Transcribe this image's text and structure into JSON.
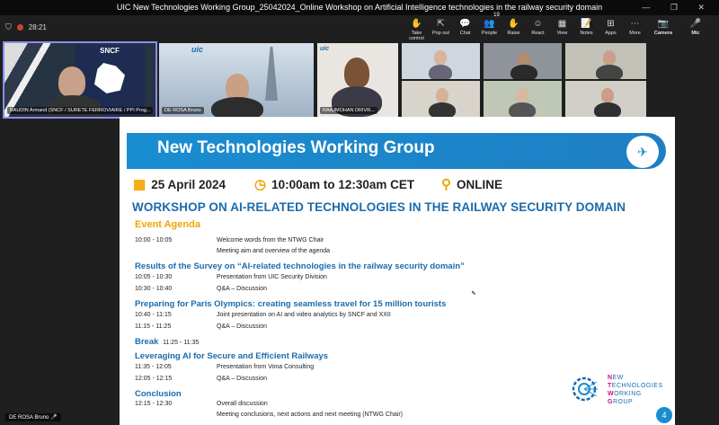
{
  "window": {
    "title": "UIC New Technologies Working Group_25042024_Online Workshop on Artificial Intelligence technologies in the railway security domain",
    "controls": "— ❐ ✕"
  },
  "toolbar": {
    "timer": "28:21",
    "items": [
      {
        "icon": "✋",
        "label": "Take control",
        "name": "take-control-button"
      },
      {
        "icon": "⇱",
        "label": "Pop out",
        "name": "pop-out-button"
      },
      {
        "icon": "💬",
        "label": "Chat",
        "name": "chat-button"
      },
      {
        "icon": "👥",
        "label": "People",
        "name": "people-button",
        "badge": "19"
      },
      {
        "icon": "✋",
        "label": "Raise",
        "name": "raise-hand-button"
      },
      {
        "icon": "☺",
        "label": "React",
        "name": "react-button"
      },
      {
        "icon": "▦",
        "label": "View",
        "name": "view-button"
      },
      {
        "icon": "📝",
        "label": "Notes",
        "name": "notes-button"
      },
      {
        "icon": "⊞",
        "label": "Apps",
        "name": "apps-button"
      },
      {
        "icon": "⋯",
        "label": "More",
        "name": "more-button"
      },
      {
        "icon": "📷",
        "label": "Camera",
        "name": "camera-button"
      },
      {
        "icon": "🎤",
        "label": "Mic",
        "name": "mic-button"
      }
    ]
  },
  "participants": {
    "t1": "BAUDIN Armand (SNCF / SURETE FERROVIAIRE / PPI Prog...",
    "t2": "DE ROSA Bruno",
    "t3": "RAAJMOHAN DRIVR...",
    "t3_logo": "uic",
    "t1_logo": "SNCF",
    "t2_logo": "uic"
  },
  "slide": {
    "banner_title": "New Technologies Working Group",
    "date": "25 April 2024",
    "time": "10:00am to 12:30am CET",
    "location": "ONLINE",
    "workshop": "WORKSHOP ON AI-RELATED TECHNOLOGIES IN THE RAILWAY SECURITY DOMAIN",
    "agenda_heading": "Event Agenda",
    "r1_time": "10:00 - 10:05",
    "r1_desc": "Welcome words from the NTWG Chair",
    "r1b_desc": "Meeting aim and overview of the agenda",
    "s1": "Results of the Survey on “AI-related technologies in the railway security domain”",
    "r2_time": "10:05 - 10:30",
    "r2_desc": "Presentation from UIC Security Division",
    "r3_time": "10:30 - 10:40",
    "r3_desc": "Q&A – Discussion",
    "s2": "Preparing for Paris Olympics: creating seamless travel for 15 million tourists",
    "r4_time": "10:40 - 11:15",
    "r4_desc": "Joint presentation on AI and video analytics by SNCF and XXII",
    "r5_time": "11:15 - 11:25",
    "r5_desc": "Q&A – Discussion",
    "break_label": "Break",
    "break_time": "11:25 - 11:35",
    "s3": "Leveraging AI for Secure and Efficient Railways",
    "r6_time": "11:35 - 12:05",
    "r6_desc": "Presentation from Vona Consulting",
    "r7_time": "12:05 - 12:15",
    "r7_desc": "Q&A – Discussion",
    "s4": "Conclusion",
    "r8_time": "12:15 - 12:30",
    "r8_desc": "Overall discussion",
    "r8b_desc": "Meeting conclusions, next actions and next meeting (NTWG Chair)",
    "logo_l1a": "N",
    "logo_l1b": "EW",
    "logo_l2a": "T",
    "logo_l2b": "ECHNOLOGIES",
    "logo_l3a": "W",
    "logo_l3b": "ORKING",
    "logo_l4a": "G",
    "logo_l4b": "ROUP",
    "page": "4"
  },
  "presenter_name": "DE ROSA Bruno",
  "colors": {
    "accent": "#1a8dd0",
    "title_blue": "#1b6cac",
    "agenda_yellow": "#f0a500"
  }
}
